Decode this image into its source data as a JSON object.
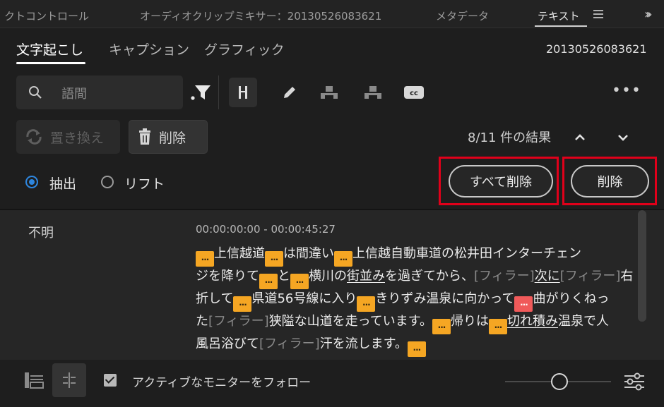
{
  "panel_tabs": [
    {
      "label": "クトコントロール"
    },
    {
      "label": "オーディオクリップミキサー：20130526083621"
    },
    {
      "label": "メタデータ"
    },
    {
      "label": "テキスト"
    }
  ],
  "subtabs": [
    {
      "label": "文字起こし"
    },
    {
      "label": "キャプション"
    },
    {
      "label": "グラフィック"
    }
  ],
  "sequence_name": "20130526083621",
  "search": {
    "placeholder": "語間"
  },
  "toolbar": {
    "more": "•••"
  },
  "actions": {
    "replace_label": "置き換え",
    "delete_label": "削除"
  },
  "results": {
    "text": "8/11 件の結果"
  },
  "mode": {
    "extract_label": "抽出",
    "lift_label": "リフト",
    "selected": "抽出"
  },
  "buttons": {
    "delete_all": "すべて削除",
    "delete": "削除"
  },
  "transcript": {
    "speaker": "不明",
    "timecode": "00:00:00:00 - 00:00:45:27",
    "pause_glyph": "...",
    "segments": {
      "s1": "上信越道",
      "s2": "は間違い",
      "s3": "上信越自動車道の松井田インターチェン",
      "s4": "ジを降りて",
      "s5": "と",
      "s6": "横川の",
      "s7": "街並み",
      "s8": "を過ぎてから、",
      "s9": "[フィラー]",
      "s10": "次に",
      "s11": "[フィラー]",
      "s12": "右",
      "s13": "折して",
      "s14": "県道56号線に入り",
      "s15": "きりずみ温泉に向かって",
      "s16": "曲がりくねっ",
      "s17": "た",
      "s18": "[フィラー]",
      "s19": "狭隘な山道を走っています。",
      "s20": "帰りは",
      "s21": "切れ積み",
      "s22": "温泉で人",
      "s23": "風呂浴びて",
      "s24": "[フィラー]",
      "s25": "汗を流します。"
    }
  },
  "footer": {
    "follow_label": "アクティブなモニターをフォロー",
    "follow_checked": true
  },
  "colors": {
    "pause": "#f5a623",
    "pause_selected": "#f05a5a",
    "highlight": "#e0001a",
    "radio_on": "#2e86de"
  }
}
